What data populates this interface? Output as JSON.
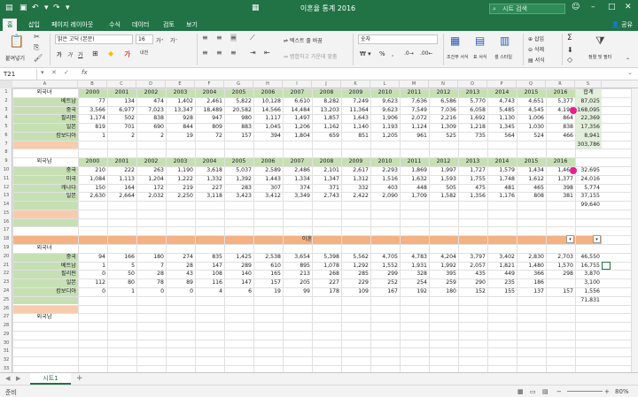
{
  "titlebar": {
    "doc_title": "이혼율 통계 2016",
    "search_placeholder": "시트 검색"
  },
  "tabs": [
    "홈",
    "삽입",
    "페이지 레이아웃",
    "수식",
    "데이터",
    "검토",
    "보기"
  ],
  "share": "공유",
  "ribbon": {
    "paste": "붙여넣기",
    "font_name": "맑은 고딕 (본문)",
    "font_size": "16",
    "wrap_text": "텍스트 줄 바꿈",
    "merge_center": "병합하고 가운데 맞춤",
    "number_format": "숫자",
    "cond_format": "조건부 서식",
    "table_format": "표 서식",
    "cell_style": "셀 스타일",
    "insert": "삽입",
    "delete": "삭제",
    "format": "서식",
    "sort_filter": "정렬 및 필터",
    "sum": "Σ"
  },
  "formula_bar": {
    "name_box": "T21",
    "fx": "fx",
    "formula": ""
  },
  "columns": [
    "A",
    "B",
    "C",
    "D",
    "E",
    "F",
    "G",
    "H",
    "I",
    "J",
    "K",
    "L",
    "M",
    "N",
    "O",
    "P",
    "Q",
    "R",
    "S"
  ],
  "years": [
    "2000",
    "2001",
    "2002",
    "2003",
    "2004",
    "2005",
    "2006",
    "2007",
    "2008",
    "2009",
    "2010",
    "2011",
    "2012",
    "2013",
    "2014",
    "2015",
    "2016"
  ],
  "total_label": "합계",
  "sections": {
    "foreign_female": "외국녀",
    "foreign_male": "외국남",
    "divorce": "이혼"
  },
  "rows": [
    {
      "r": 1,
      "label": "외국녀",
      "vals": [],
      "total": ""
    },
    {
      "r": 2,
      "label": "베트남",
      "vals": [
        "77",
        "134",
        "474",
        "1,402",
        "2,461",
        "5,822",
        "10,128",
        "6,610",
        "8,282",
        "7,249",
        "9,623",
        "7,636",
        "6,586",
        "5,770",
        "4,743",
        "4,651",
        "5,377"
      ],
      "total": "87,025"
    },
    {
      "r": 3,
      "label": "중국",
      "vals": [
        "3,566",
        "6,977",
        "7,023",
        "13,347",
        "18,489",
        "20,582",
        "14,566",
        "14,484",
        "13,203",
        "11,364",
        "9,623",
        "7,549",
        "7,036",
        "6,058",
        "5,485",
        "4,545",
        "4,198"
      ],
      "total": "168,095"
    },
    {
      "r": 4,
      "label": "필리핀",
      "vals": [
        "1,174",
        "502",
        "838",
        "928",
        "947",
        "980",
        "1,117",
        "1,497",
        "1,857",
        "1,643",
        "1,906",
        "2,072",
        "2,216",
        "1,692",
        "1,130",
        "1,006",
        "864"
      ],
      "total": "22,369"
    },
    {
      "r": 5,
      "label": "일본",
      "vals": [
        "819",
        "701",
        "690",
        "844",
        "809",
        "883",
        "1,045",
        "1,206",
        "1,162",
        "1,140",
        "1,193",
        "1,124",
        "1,309",
        "1,218",
        "1,345",
        "1,030",
        "838"
      ],
      "total": "17,356"
    },
    {
      "r": 6,
      "label": "캄보디아",
      "vals": [
        "1",
        "2",
        "2",
        "19",
        "72",
        "157",
        "394",
        "1,804",
        "659",
        "851",
        "1,205",
        "961",
        "525",
        "735",
        "564",
        "524",
        "466"
      ],
      "total": "8,941"
    },
    {
      "r": 7,
      "label": "",
      "vals": [],
      "total": "303,786"
    },
    {
      "r": 9,
      "label": "외국남",
      "vals": [],
      "total": ""
    },
    {
      "r": 10,
      "label": "중국",
      "vals": [
        "210",
        "222",
        "263",
        "1,190",
        "3,618",
        "5,037",
        "2,589",
        "2,486",
        "2,101",
        "2,617",
        "2,293",
        "1,869",
        "1,997",
        "1,727",
        "1,579",
        "1,434",
        "1,463"
      ],
      "total": "32,695"
    },
    {
      "r": 11,
      "label": "미국",
      "vals": [
        "1,084",
        "1,113",
        "1,204",
        "1,222",
        "1,332",
        "1,392",
        "1,443",
        "1,334",
        "1,347",
        "1,312",
        "1,516",
        "1,632",
        "1,593",
        "1,755",
        "1,748",
        "1,612",
        "1,377"
      ],
      "total": "24,016"
    },
    {
      "r": 12,
      "label": "캐나다",
      "vals": [
        "150",
        "164",
        "172",
        "219",
        "227",
        "283",
        "307",
        "374",
        "371",
        "332",
        "403",
        "448",
        "505",
        "475",
        "481",
        "465",
        "398"
      ],
      "total": "5,774"
    },
    {
      "r": 13,
      "label": "일본",
      "vals": [
        "2,630",
        "2,664",
        "2,032",
        "2,250",
        "3,118",
        "3,423",
        "3,412",
        "3,349",
        "2,743",
        "2,422",
        "2,090",
        "1,709",
        "1,582",
        "1,356",
        "1,176",
        "808",
        "381"
      ],
      "total": "37,155"
    },
    {
      "r": 14,
      "label": "",
      "vals": [],
      "total": "99,640"
    },
    {
      "r": 19,
      "label": "외국녀",
      "vals": [],
      "total": ""
    },
    {
      "r": 20,
      "label": "중국",
      "vals": [
        "94",
        "166",
        "180",
        "274",
        "835",
        "1,425",
        "2,538",
        "3,654",
        "5,398",
        "5,562",
        "4,705",
        "4,783",
        "4,204",
        "3,797",
        "3,402",
        "2,830",
        "2,703"
      ],
      "total": "46,550"
    },
    {
      "r": 21,
      "label": "베트남",
      "vals": [
        "1",
        "5",
        "7",
        "28",
        "147",
        "289",
        "610",
        "895",
        "1,078",
        "1,292",
        "1,552",
        "1,931",
        "1,992",
        "2,057",
        "1,821",
        "1,480",
        "1,570"
      ],
      "total": "16,755"
    },
    {
      "r": 22,
      "label": "필리핀",
      "vals": [
        "0",
        "50",
        "28",
        "43",
        "108",
        "140",
        "165",
        "213",
        "268",
        "285",
        "299",
        "328",
        "395",
        "435",
        "449",
        "366",
        "298"
      ],
      "total": "3,870"
    },
    {
      "r": 23,
      "label": "일본",
      "vals": [
        "112",
        "80",
        "78",
        "89",
        "116",
        "147",
        "157",
        "205",
        "227",
        "229",
        "252",
        "254",
        "259",
        "290",
        "235",
        "186"
      ],
      "total": "3,100"
    },
    {
      "r": 24,
      "label": "캄보디아",
      "vals": [
        "0",
        "1",
        "0",
        "0",
        "4",
        "6",
        "19",
        "99",
        "178",
        "109",
        "167",
        "192",
        "180",
        "152",
        "155",
        "137",
        "157"
      ],
      "total": "1,556"
    },
    {
      "r": 25,
      "label": "",
      "vals": [],
      "total": "71,831"
    },
    {
      "r": 27,
      "label": "외국남",
      "vals": [],
      "total": ""
    }
  ],
  "sheet_tab": "시트1",
  "status": {
    "ready": "준비",
    "zoom": "80%"
  }
}
